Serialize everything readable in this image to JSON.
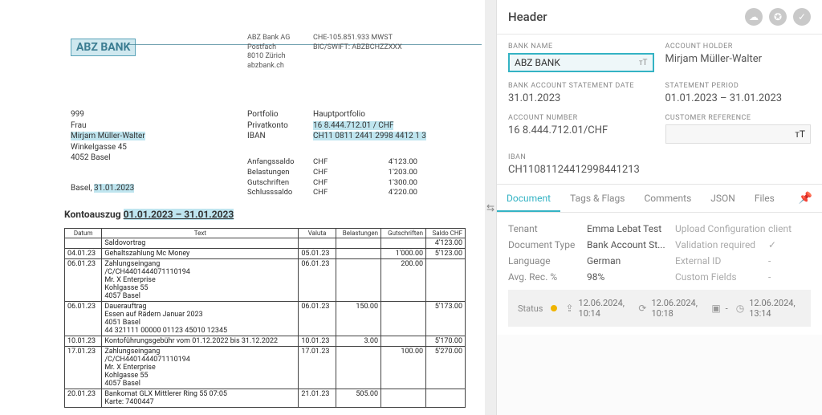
{
  "document": {
    "bank_logo_text": "ABZ BANK",
    "bank_block": [
      "ABZ Bank AG",
      "Postfach",
      "8010 Zürich",
      "abzbank.ch"
    ],
    "mwst": "CHE-105.851.933 MWST",
    "bic": "BIC/SWIFT: ABZBCHZZXXX",
    "address": {
      "code": "999",
      "salutation": "Frau",
      "name": "Mirjam Müller-Walter",
      "street": "Winkelgasse 45",
      "city": "4052 Basel"
    },
    "portfolio_labels": [
      "Portfolio",
      "Privatkonto",
      "IBAN"
    ],
    "portfolio_values": [
      "Hauptportfolio",
      "16 8.444.712.01 / CHF",
      "CH11 0811 2441 2998 4412 1 3"
    ],
    "balances": {
      "labels": [
        "Anfangssaldo",
        "Belastungen",
        "Gutschriften",
        "Schlusssaldo"
      ],
      "currency": "CHF",
      "values": [
        "4'123.00",
        "1'203.00",
        "1'300.00",
        "4'220.00"
      ]
    },
    "basel": "Basel,",
    "basel_date": "31.01.2023",
    "statement_title_prefix": "Kontoauszug",
    "statement_title_range": "01.01.2023 – 31.01.2023",
    "table": {
      "headers": [
        "Datum",
        "Text",
        "Valuta",
        "Belastungen",
        "Gutschriften",
        "Saldo CHF"
      ],
      "rows": [
        {
          "d": "",
          "t": "Saldovortrag",
          "v": "",
          "b": "",
          "g": "",
          "s": "4'123.00"
        },
        {
          "d": "04.01.23",
          "t": "Gehaltszahlung Mc Money",
          "v": "05.01.23",
          "b": "",
          "g": "1'000.00",
          "s": "5'123.00"
        },
        {
          "d": "06.01.23",
          "t": "Zahlungseingang\n/C/CH4401444071110194\nMr. X Enterprise\nKohlgasse 55\n4057 Basel",
          "v": "06.01.23",
          "b": "",
          "g": "200.00",
          "s": ""
        },
        {
          "d": "06.01.23",
          "t": "Dauerauftrag\nEssen auf Rädern Januar 2023\n4051 Basel\n44 321111 00000 01123 45010 12345",
          "v": "06.01.23",
          "b": "150.00",
          "g": "",
          "s": "5'173.00"
        },
        {
          "d": "10.01.23",
          "t": "Kontoführungsgebühr vom 01.12.2022 bis 31.12.2022",
          "v": "10.01.23",
          "b": "3.00",
          "g": "",
          "s": "5'170.00"
        },
        {
          "d": "17.01.23",
          "t": "Zahlungseingang\n/C/CH4401444071110194\nMr. X Enterprise\nKohlgasse 55\n4057 Basel",
          "v": "17.01.23",
          "b": "",
          "g": "100.00",
          "s": "5'270.00"
        },
        {
          "d": "20.01.23",
          "t": "Bankomat GLX Mittlerer Ring 55 07:05\nKarte: 7400447",
          "v": "21.01.23",
          "b": "505.00",
          "g": "",
          "s": ""
        }
      ]
    }
  },
  "panel": {
    "title": "Header",
    "fields": {
      "bank_name": {
        "label": "BANK NAME",
        "value": "ABZ BANK"
      },
      "account_holder": {
        "label": "ACCOUNT HOLDER",
        "value": "Mirjam Müller-Walter"
      },
      "statement_date": {
        "label": "BANK ACCOUNT STATEMENT DATE",
        "value": "31.01.2023"
      },
      "statement_period": {
        "label": "STATEMENT PERIOD",
        "value": "01.01.2023 – 31.01.2023"
      },
      "account_number": {
        "label": "ACCOUNT NUMBER",
        "value": "16 8.444.712.01/CHF"
      },
      "customer_reference": {
        "label": "CUSTOMER REFERENCE",
        "value": ""
      },
      "iban": {
        "label": "IBAN",
        "value": "CH11081124412998441213"
      }
    },
    "tabs": [
      "Document",
      "Tags & Flags",
      "Comments",
      "JSON",
      "Files"
    ],
    "active_tab": "Document",
    "meta": {
      "tenant_label": "Tenant",
      "tenant_value": "Emma Lebat Test",
      "upload_cfg_label": "Upload Configuration",
      "upload_cfg_value": "client",
      "doctype_label": "Document Type",
      "doctype_value": "Bank Account St...",
      "validation_label": "Validation required",
      "language_label": "Language",
      "language_value": "German",
      "external_id_label": "External ID",
      "external_id_value": "-",
      "avgrec_label": "Avg. Rec. %",
      "avgrec_value": "98%",
      "custom_label": "Custom Fields",
      "custom_value": "-"
    },
    "status": {
      "label": "Status",
      "uploaded": "12.06.2024, 10:14",
      "processed": "12.06.2024, 10:18",
      "archived": "-",
      "last": "12.06.2024, 13:14"
    }
  }
}
